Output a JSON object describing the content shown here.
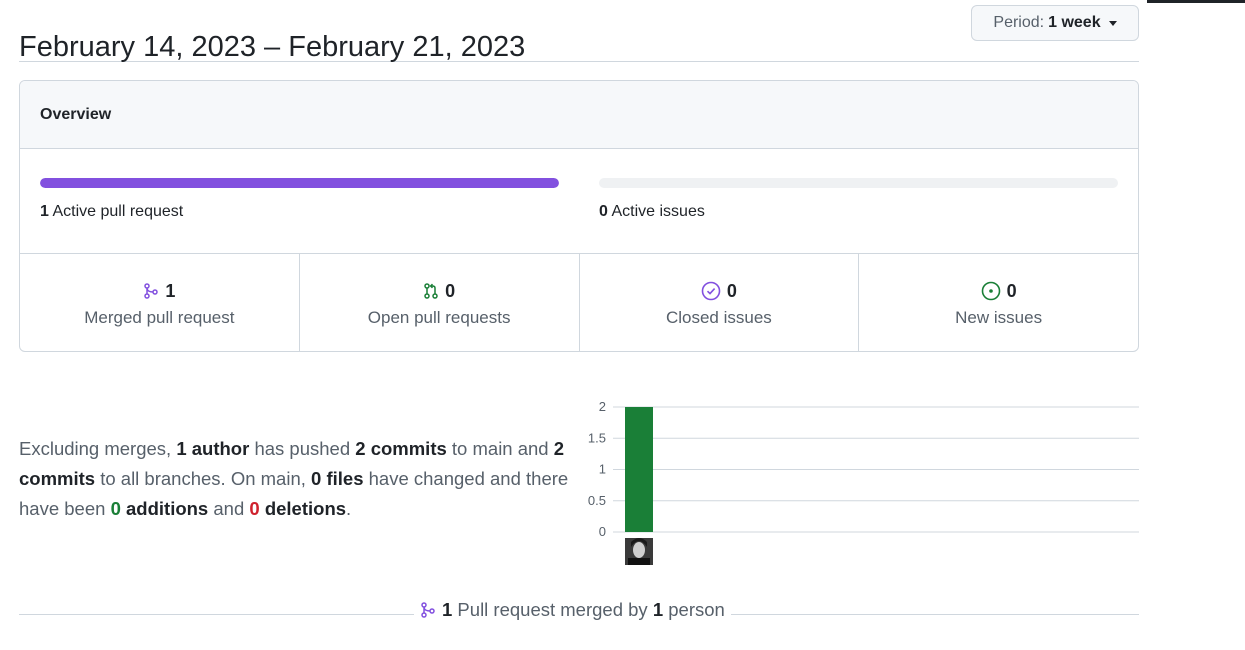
{
  "header": {
    "title": "February 14, 2023 – February 21, 2023",
    "period_label": "Period:",
    "period_value": "1 week"
  },
  "overview": {
    "title": "Overview",
    "pull_requests": {
      "count": "1",
      "label": "Active pull request",
      "fill_fraction": 1.0,
      "color": "#8250df"
    },
    "issues": {
      "count": "0",
      "label": "Active issues",
      "fill_fraction": 0.0
    },
    "stats": [
      {
        "icon": "merged-pr-icon",
        "count": "1",
        "label": "Merged pull request",
        "color": "#8250df"
      },
      {
        "icon": "open-pr-icon",
        "count": "0",
        "label": "Open pull requests",
        "color": "#1a7f37"
      },
      {
        "icon": "closed-issue-icon",
        "count": "0",
        "label": "Closed issues",
        "color": "#8250df"
      },
      {
        "icon": "new-issue-icon",
        "count": "0",
        "label": "New issues",
        "color": "#1a7f37"
      }
    ]
  },
  "summary": {
    "p1": "Excluding merges, ",
    "authors": "1 author",
    "p2": " has pushed ",
    "commits_main": "2 commits",
    "p3": " to main and ",
    "commits_all": "2 commits",
    "p4": " to all branches. On main, ",
    "files": "0 files",
    "p5": " have changed and there have been ",
    "additions_num": "0",
    "additions_word": " additions",
    "p6": " and ",
    "deletions_num": "0",
    "deletions_word": " deletions",
    "p7": "."
  },
  "chart_data": {
    "type": "bar",
    "categories": [
      "contributor"
    ],
    "values": [
      2
    ],
    "ylim": [
      0,
      2
    ],
    "yticks": [
      "0",
      "0.5",
      "1",
      "1.5",
      "2"
    ],
    "grid": true,
    "color": "#1a7f37"
  },
  "footer": {
    "count": "1",
    "text1": " Pull request merged by ",
    "people": "1",
    "text2": " person"
  }
}
